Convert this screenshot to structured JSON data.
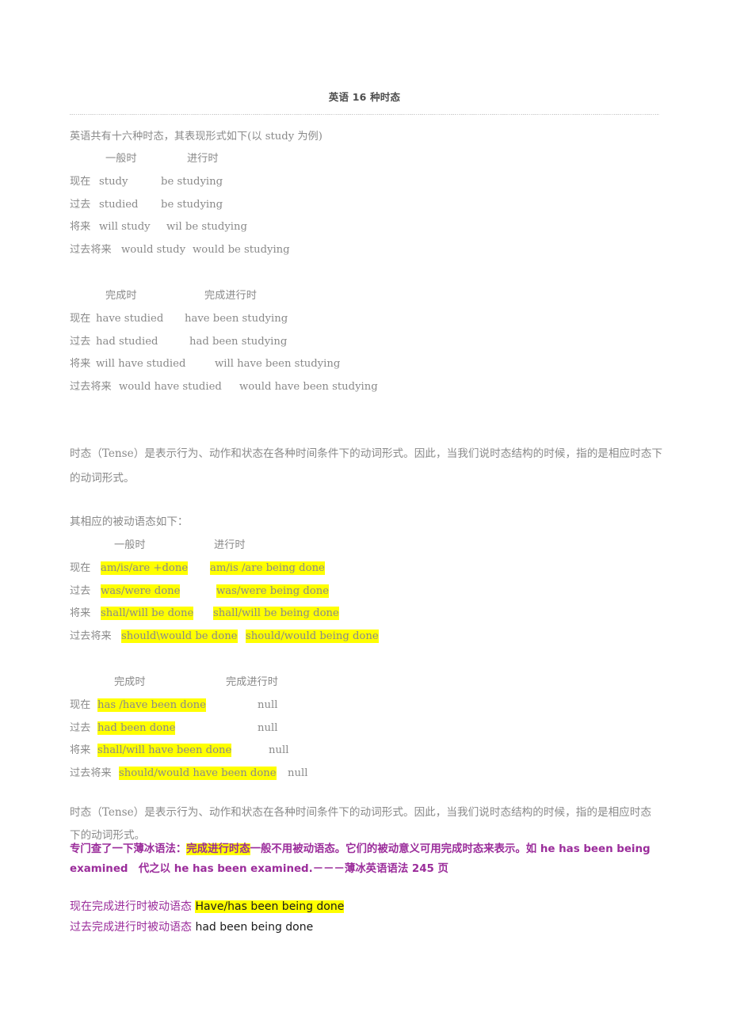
{
  "document": {
    "title": "英语 16 种时态",
    "intro": "英语共有十六种时态，其表现形式如下(以 study 为例)"
  },
  "active_tables": [
    {
      "col1_header": "一般时",
      "col2_header": "进行时",
      "rows": [
        {
          "label": "现在",
          "simple": "study",
          "progressive": "be studying"
        },
        {
          "label": "过去",
          "simple": "studied",
          "progressive": "be studying"
        },
        {
          "label": "将来",
          "simple": "will study",
          "progressive": "wil be studying"
        },
        {
          "label": "过去将来",
          "simple": "would study",
          "progressive": "would be studying"
        }
      ]
    },
    {
      "col1_header": "完成时",
      "col2_header": "完成进行时",
      "rows": [
        {
          "label": "现在",
          "simple": "have studied",
          "progressive": "have been studying"
        },
        {
          "label": "过去",
          "simple": "had studied",
          "progressive": "had been studying"
        },
        {
          "label": "将来",
          "simple": "will have studied",
          "progressive": "will have been studying"
        },
        {
          "label": "过去将来",
          "simple": "would have studied",
          "progressive": "would have been studying"
        }
      ]
    }
  ],
  "paragraphs": {
    "tense_definition": "时态（Tense）是表示行为、动作和状态在各种时间条件下的动词形式。因此，当我们说时态结构的时候，指的是相应时态下的动词形式。",
    "passive_lead": "其相应的被动语态如下："
  },
  "passive_tables": [
    {
      "col1_header": "一般时",
      "col2_header": "进行时",
      "rows": [
        {
          "label": "现在",
          "simple": "am/is/are +done",
          "progressive": "am/is /are being done"
        },
        {
          "label": "过去",
          "simple": "was/were done",
          "progressive": "was/were being done"
        },
        {
          "label": "将来",
          "simple": "shall/will be done",
          "progressive": "shall/will be being done"
        },
        {
          "label": "过去将来",
          "simple": "should\\would be done",
          "progressive": "should/would being done"
        }
      ]
    },
    {
      "col1_header": "完成时",
      "col2_header": "完成进行时",
      "rows": [
        {
          "label": "现在",
          "simple": "has /have been done",
          "progressive": "null"
        },
        {
          "label": "过去",
          "simple": "had been done",
          "progressive": "null"
        },
        {
          "label": "将来",
          "simple": "shall/will have been done",
          "progressive": "null"
        },
        {
          "label": "过去将来",
          "simple": "should/would have been done",
          "progressive": "null"
        }
      ]
    }
  ],
  "note": {
    "definition_repeat": "时态（Tense）是表示行为、动作和状态在各种时间条件下的动词形式。因此，当我们说时态结构的时候，指的是相应时态下的动词形式。",
    "lookup_prefix": " 专门查了一下薄冰语法：",
    "highlighted_term": "完成进行时态",
    "lookup_body": "一般不用被动语态。它们的被动意义可用完成时态来表示。如 he has been being examined",
    "lookup_replace": "　代之以 he has been examined.－－－薄冰英语语法 245 页"
  },
  "final_lines": [
    {
      "label": "现在完成进行时被动语态 ",
      "form": "Have/has been being done",
      "highlighted": true
    },
    {
      "label": "过去完成进行时被动语态 ",
      "form": "had been being done",
      "highlighted": false
    }
  ],
  "colors": {
    "highlight": "#ffff00",
    "purple": "#9b2d9b",
    "body_text": "#8a8a8a",
    "rule": "#c9c9c9"
  }
}
